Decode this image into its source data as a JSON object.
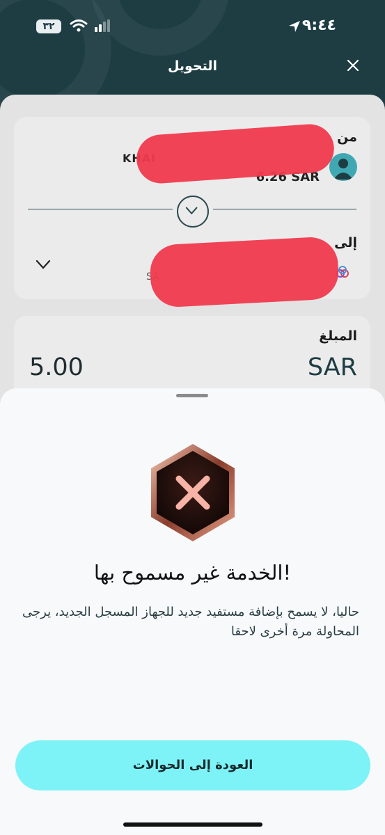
{
  "status_bar": {
    "battery": "٣٢",
    "time": "٩:٤٤"
  },
  "header": {
    "title": "التحويل"
  },
  "transfer": {
    "from_label": "من",
    "from_account_name": "KHAI",
    "from_balance": "6.26 SAR",
    "to_label": "إلى",
    "to_account_prefix": "SA",
    "amount_label": "المبلغ",
    "amount": "5.00",
    "currency": "SAR"
  },
  "modal": {
    "title": "الخدمة غير مسموح بها!",
    "message": "حاليا، لا يسمح بإضافة مستفيد جديد للجهاز المسجل الجديد، يرجى المحاولة مرة أخرى لاحقا",
    "button": "العودة إلى الحوالات"
  },
  "colors": {
    "header_bg": "#1d3d43",
    "accent_button": "#7df3f7",
    "redaction": "#f13a4e",
    "badge_accent": "#f2a99a"
  },
  "icons": [
    "wifi-icon",
    "signal-icon",
    "location-icon",
    "close-icon",
    "avatar-icon",
    "chevron-down-icon",
    "bank-logo-icon",
    "error-badge-icon"
  ]
}
